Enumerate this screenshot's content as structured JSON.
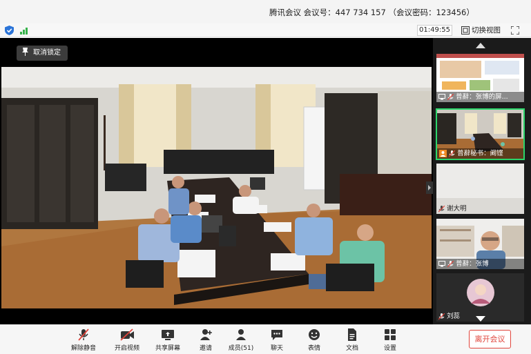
{
  "window": {
    "title": "腾讯会议  会议号：447 734 157 （会议密码：123456）"
  },
  "infobar": {
    "timer": "01:49:55",
    "switch_view_label": "切换视图"
  },
  "stage": {
    "unlock_label": "取消锁定"
  },
  "participants": [
    {
      "name": "普辭：张博的屏...",
      "muted": true
    },
    {
      "name": "普辭秘书：阚铿",
      "muted": true,
      "active": true
    },
    {
      "name": "谢大明",
      "muted": true
    },
    {
      "name": "普辭：张博",
      "muted": true
    },
    {
      "name": "刘蕊",
      "muted": true
    }
  ],
  "toolbar": {
    "mute_label": "解除静音",
    "video_label": "开启视频",
    "share_label": "共享屏幕",
    "invite_label": "邀请",
    "members_label": "成员(51)",
    "chat_label": "聊天",
    "reaction_label": "表情",
    "docs_label": "文档",
    "settings_label": "设置",
    "leave_label": "离开会议"
  },
  "colors": {
    "active_border": "#2bd66b",
    "leave_red": "#e0443b",
    "mute_red": "#e0443b",
    "shield_blue": "#2b74d8",
    "signal_green": "#36b24a"
  }
}
